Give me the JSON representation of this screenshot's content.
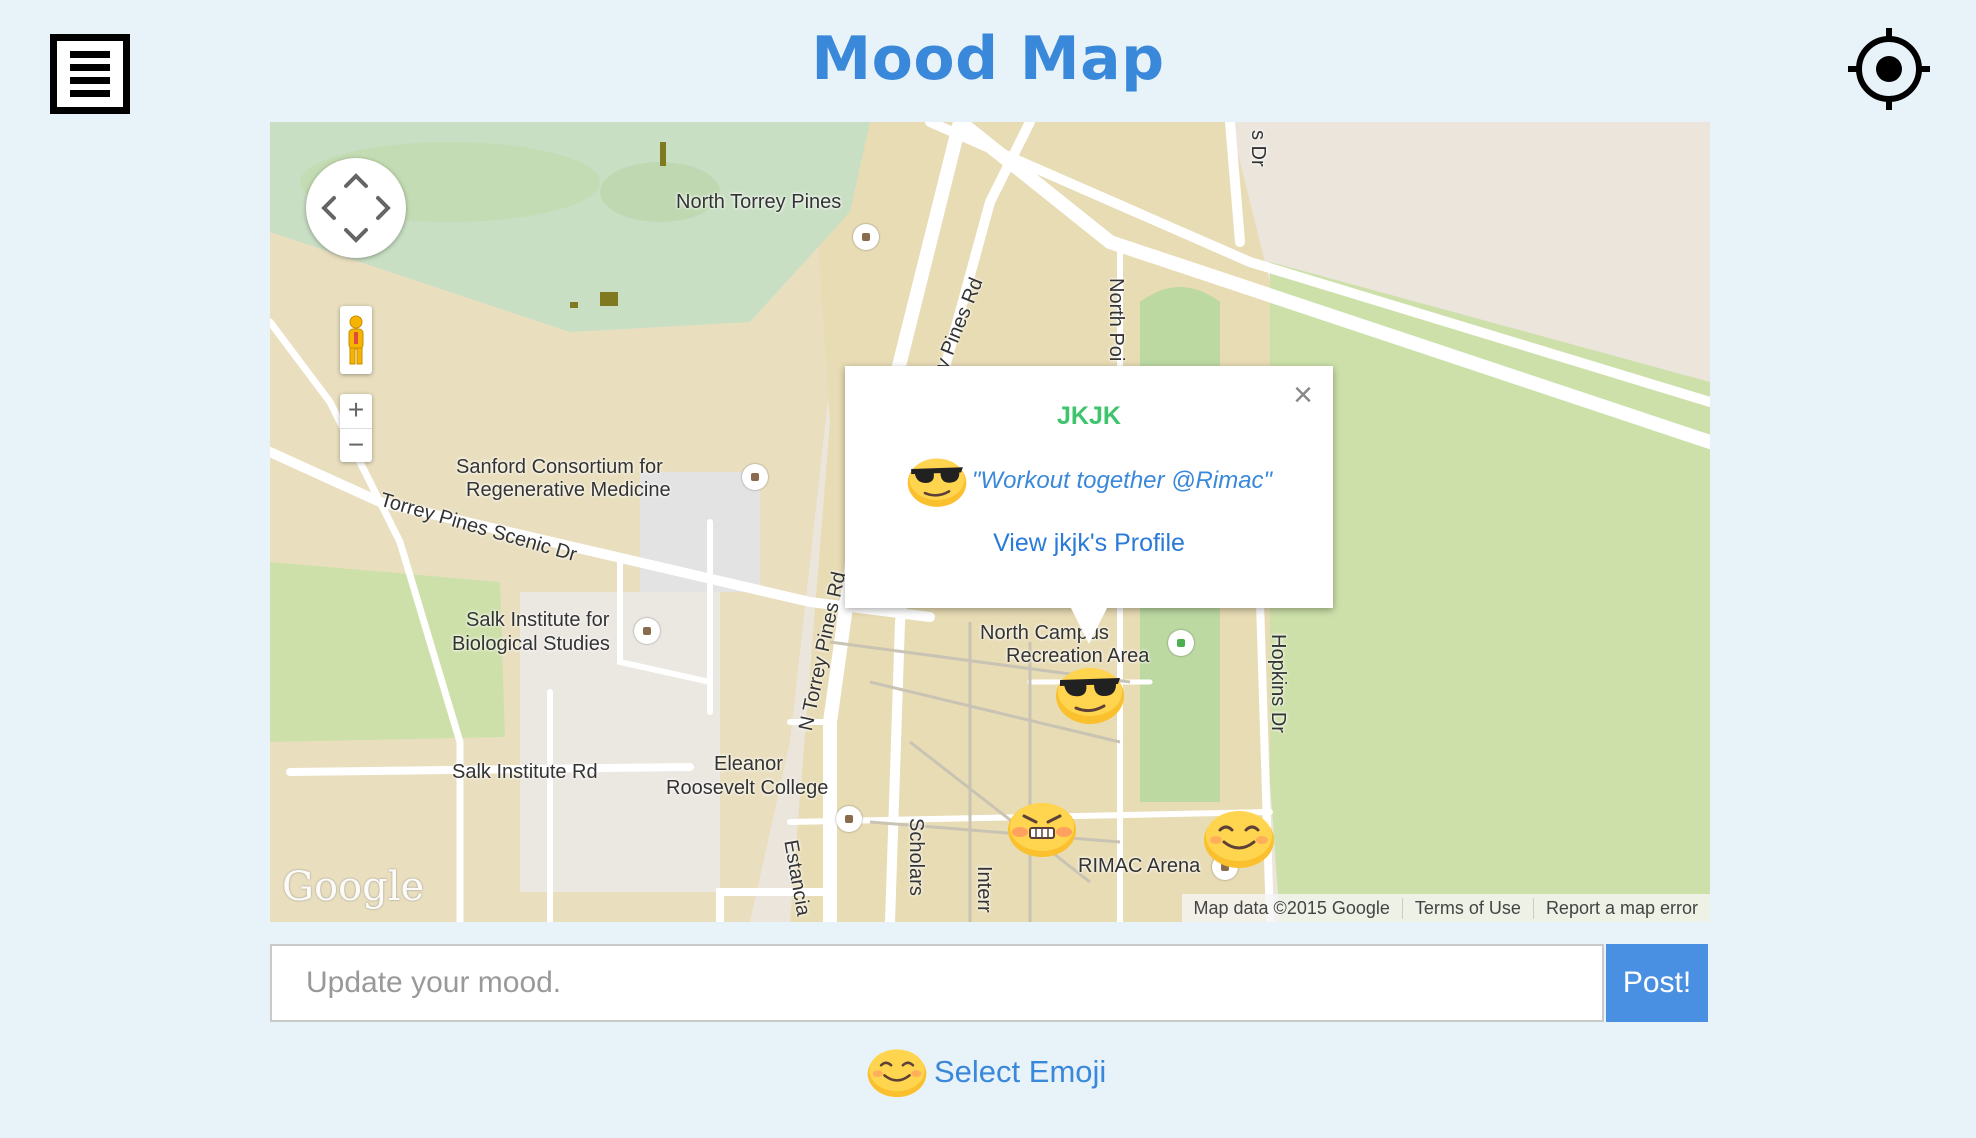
{
  "header": {
    "title": "Mood Map",
    "menu_icon": "menu-icon",
    "locate_icon": "crosshair-icon"
  },
  "map": {
    "labels": {
      "north_torrey_pines": "North Torrey Pines",
      "n_torrey_pines_rd_top": "y Pines Rd",
      "north_point": "North Poi",
      "s_dr": "s Dr",
      "sanford": "Sanford Consortium for",
      "sanford_2": "Regenerative Medicine",
      "scenic_dr": "Torrey Pines Scenic Dr",
      "salk": "Salk Institute for",
      "salk_2": "Biological Studies",
      "n_torrey_pines_rd": "N Torrey Pines Rd",
      "north_campus": "North Campus",
      "north_campus_2": "Recreation Area",
      "hopkins_dr": "Hopkins Dr",
      "salk_rd": "Salk Institute Rd",
      "eleanor": "Eleanor",
      "eleanor_2": "Roosevelt College",
      "scholars": "Scholars",
      "interr": "Interr",
      "estancia": "Estancia",
      "rimac": "RIMAC Arena"
    },
    "google_logo": "Google",
    "attribution": {
      "data": "Map data ©2015 Google",
      "terms": "Terms of Use",
      "report": "Report a map error"
    },
    "controls": {
      "zoom_in": "+",
      "zoom_out": "−"
    },
    "markers": [
      "sunglasses-emoji",
      "angry-emoji",
      "smile-emoji"
    ]
  },
  "popup": {
    "username": "JKJK",
    "quote": "\"Workout together @Rimac\"",
    "profile_link": "View jkjk's Profile",
    "close": "×",
    "emoji": "sunglasses-emoji"
  },
  "composer": {
    "placeholder": "Update your mood.",
    "post_label": "Post!",
    "select_emoji_label": "Select Emoji",
    "select_emoji_icon": "smile-emoji"
  },
  "colors": {
    "accent": "#3a88da",
    "username": "#3ec46d",
    "post_button": "#4a90e2",
    "background": "#e8f2f9"
  }
}
